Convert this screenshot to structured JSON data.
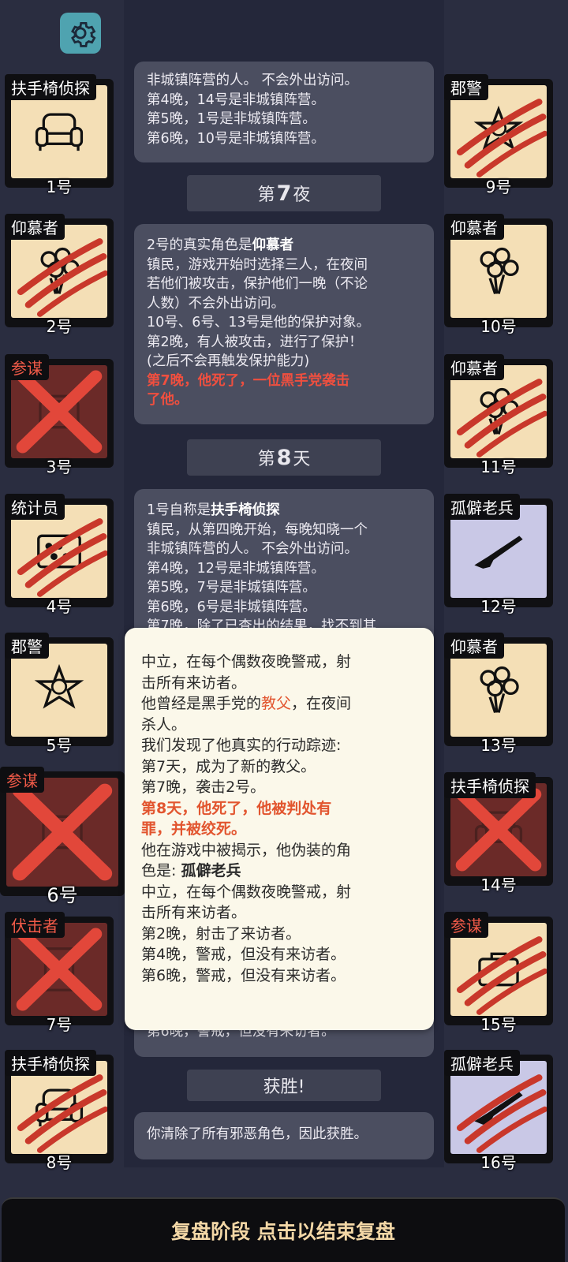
{
  "settings_icon": "gear-icon",
  "colors": {
    "accent": "#4fa3b0",
    "danger": "#ef4f3f",
    "card": "#4b4e60",
    "popup": "#fbf8ea"
  },
  "log": {
    "card_top": [
      "非城镇阵营的人。 不会外出访问。",
      "第4晚，14号是非城镇阵营。",
      "第5晚，1号是非城镇阵营。",
      "第6晚，10号是非城镇阵营。"
    ],
    "phase1": {
      "prefix": "第",
      "num": "7",
      "suffix": "夜"
    },
    "card2": {
      "head_pre": "2号的真实角色是",
      "head_role": "仰慕者",
      "lines": [
        "镇民，游戏开始时选择三人，在夜间",
        "若他们被攻击，保护他们一晚（不论",
        "人数）不会外出访问。",
        "10号、6号、13号是他的保护对象。",
        "第2晚，有人被攻击，进行了保护！",
        "(之后不会再触发保护能力)"
      ],
      "red": [
        "第7晚，他死了，一位黑手党袭击",
        "了他。"
      ]
    },
    "phase2": {
      "prefix": "第",
      "num": "8",
      "suffix": "天"
    },
    "card3": {
      "head_pre": "1号自称是",
      "head_role": "扶手椅侦探",
      "lines": [
        "镇民，从第四晚开始，每晚知晓一个",
        "非城镇阵营的人。 不会外出访问。",
        "第4晚，12号是非城镇阵营。",
        "第5晚，7号是非城镇阵营。",
        "第6晚，6号是非城镇阵营。",
        "第7晚，除了已查出的结果，找不到其"
      ],
      "tail": "第6晚，警戒，但没有来访者。"
    },
    "phase3": "获胜!",
    "card4": "你清除了所有邪恶角色，因此获胜。"
  },
  "popup": {
    "l1": "中立，在每个偶数夜晚警戒，射",
    "l2": "击所有来访者。",
    "l3_pre": "他曾经是黑手党的",
    "l3_hl": "教父",
    "l3_post": "，在夜间",
    "l4": "杀人。",
    "l5": "我们发现了他真实的行动踪迹:",
    "l6": "第7天，成为了新的教父。",
    "l7": "第7晚，袭击2号。",
    "red1": "第8天，他死了，他被判处有",
    "red2": "罪，并被绞死。",
    "l8": "他在游戏中被揭示，他伪装的角",
    "l9_pre": "色是: ",
    "l9_b": "孤僻老兵",
    "l10": "中立，在每个偶数夜晚警戒，射",
    "l11": "击所有来访者。",
    "l12": "第2晚，射击了来访者。",
    "l13": "第4晚，警戒，但没有来访者。",
    "l14": "第6晚，警戒，但没有来访者。"
  },
  "players_left": [
    {
      "num": "1号",
      "role": "扶手椅侦探",
      "icon": "armchair-icon",
      "state": "alive"
    },
    {
      "num": "2号",
      "role": "仰慕者",
      "icon": "bouquet-icon",
      "state": "clawed"
    },
    {
      "num": "3号",
      "role": "参谋",
      "icon": "briefcase-icon",
      "state": "executed"
    },
    {
      "num": "4号",
      "role": "统计员",
      "icon": "abacus-icon",
      "state": "clawed"
    },
    {
      "num": "5号",
      "role": "郡警",
      "icon": "sheriff-badge-icon",
      "state": "alive"
    },
    {
      "num": "6号",
      "role": "参谋",
      "icon": "briefcase-icon",
      "state": "executed"
    },
    {
      "num": "7号",
      "role": "伏击者",
      "icon": "door-icon",
      "state": "executed"
    },
    {
      "num": "8号",
      "role": "扶手椅侦探",
      "icon": "armchair-icon",
      "state": "clawed"
    }
  ],
  "players_right": [
    {
      "num": "9号",
      "role": "郡警",
      "icon": "sheriff-badge-icon",
      "state": "clawed"
    },
    {
      "num": "10号",
      "role": "仰慕者",
      "icon": "bouquet-icon",
      "state": "alive"
    },
    {
      "num": "11号",
      "role": "仰慕者",
      "icon": "bouquet-icon",
      "state": "clawed"
    },
    {
      "num": "12号",
      "role": "孤僻老兵",
      "icon": "rifle-icon",
      "state": "alive"
    },
    {
      "num": "13号",
      "role": "仰慕者",
      "icon": "bouquet-icon",
      "state": "alive"
    },
    {
      "num": "14号",
      "role": "扶手椅侦探",
      "icon": "armchair-icon",
      "state": "executed"
    },
    {
      "num": "15号",
      "role": "参谋",
      "icon": "briefcase-icon",
      "state": "clawed"
    },
    {
      "num": "16号",
      "role": "孤僻老兵",
      "icon": "rifle-icon",
      "state": "clawed"
    }
  ],
  "bottom_bar": "复盘阶段 点击以结束复盘"
}
